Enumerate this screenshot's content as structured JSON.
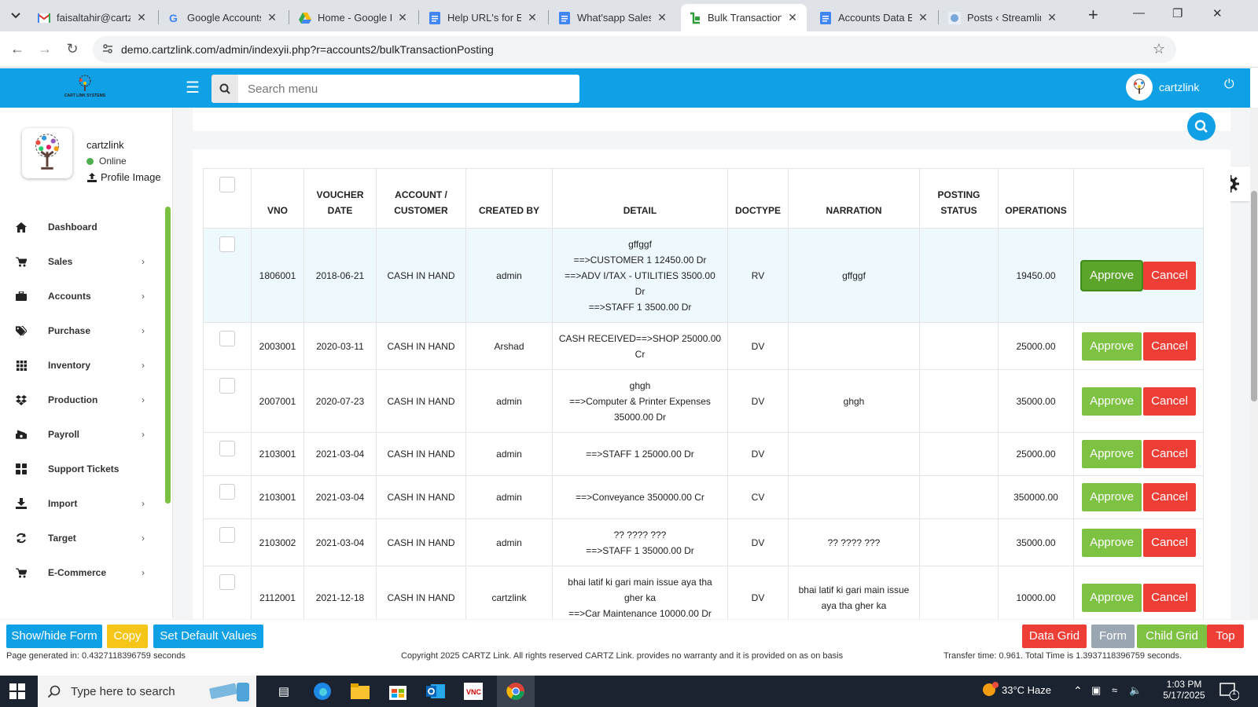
{
  "browser": {
    "tabs": [
      {
        "label": "faisaltahir@cartzli",
        "icon": "gmail-icon",
        "active": false
      },
      {
        "label": "Google Accounts",
        "icon": "google-icon",
        "active": false
      },
      {
        "label": "Home - Google Dr",
        "icon": "drive-icon",
        "active": false
      },
      {
        "label": "Help URL's for ERP",
        "icon": "docs-icon",
        "active": false
      },
      {
        "label": "What'sapp Sales M",
        "icon": "docs-icon",
        "active": false
      },
      {
        "label": "Bulk Transaction P",
        "icon": "cartz-icon",
        "active": true
      },
      {
        "label": "Accounts Data Ent",
        "icon": "docs-icon",
        "active": false
      },
      {
        "label": "Posts ‹ Streamline",
        "icon": "site-icon",
        "active": false
      }
    ],
    "url": "demo.cartzlink.com/admin/indexyii.php?r=accounts2/bulkTransactionPosting"
  },
  "header": {
    "logo_text": "CART LINK SYSTEMS",
    "search_placeholder": "Search menu",
    "user": "cartzlink"
  },
  "sidebar": {
    "profile_name": "cartzlink",
    "status": "Online",
    "profile_image_label": "Profile Image",
    "items": [
      {
        "label": "Dashboard",
        "icon": "home-icon",
        "has_children": false
      },
      {
        "label": "Sales",
        "icon": "cart-icon",
        "has_children": true
      },
      {
        "label": "Accounts",
        "icon": "briefcase-icon",
        "has_children": true
      },
      {
        "label": "Purchase",
        "icon": "tags-icon",
        "has_children": true
      },
      {
        "label": "Inventory",
        "icon": "grid-icon",
        "has_children": true
      },
      {
        "label": "Production",
        "icon": "dropbox-icon",
        "has_children": true
      },
      {
        "label": "Payroll",
        "icon": "money-icon",
        "has_children": true
      },
      {
        "label": "Support Tickets",
        "icon": "ticket-icon",
        "has_children": false
      },
      {
        "label": "Import",
        "icon": "import-icon",
        "has_children": true
      },
      {
        "label": "Target",
        "icon": "refresh-icon",
        "has_children": true
      },
      {
        "label": "E-Commerce",
        "icon": "cart-icon",
        "has_children": true
      }
    ]
  },
  "table": {
    "columns": [
      "VNO",
      "VOUCHER DATE",
      "ACCOUNT / CUSTOMER",
      "CREATED BY",
      "DETAIL",
      "DOCTYPE",
      "NARRATION",
      "POSTING STATUS",
      "OPERATIONS"
    ],
    "approve_label": "Approve",
    "cancel_label": "Cancel",
    "rows": [
      {
        "vno": "1806001",
        "date": "2018-06-21",
        "account": "CASH IN HAND",
        "created_by": "admin",
        "detail": [
          "gffggf",
          "==>CUSTOMER 1 12450.00 Dr",
          "==>ADV I/TAX - UTILITIES 3500.00",
          "Dr",
          "==>STAFF 1 3500.00 Dr"
        ],
        "doctype": "RV",
        "narration": "gffggf",
        "posting_status": "",
        "amount": "19450.00"
      },
      {
        "vno": "2003001",
        "date": "2020-03-11",
        "account": "CASH IN HAND",
        "created_by": "Arshad",
        "detail": [
          "CASH RECEIVED==>SHOP 25000.00",
          "Cr"
        ],
        "doctype": "DV",
        "narration": "",
        "posting_status": "",
        "amount": "25000.00"
      },
      {
        "vno": "2007001",
        "date": "2020-07-23",
        "account": "CASH IN HAND",
        "created_by": "admin",
        "detail": [
          "ghgh",
          "==>Computer & Printer Expenses",
          "35000.00 Dr"
        ],
        "doctype": "DV",
        "narration": "ghgh",
        "posting_status": "",
        "amount": "35000.00"
      },
      {
        "vno": "2103001",
        "date": "2021-03-04",
        "account": "CASH IN HAND",
        "created_by": "admin",
        "detail": [
          "==>STAFF 1 25000.00 Dr"
        ],
        "doctype": "DV",
        "narration": "",
        "posting_status": "",
        "amount": "25000.00"
      },
      {
        "vno": "2103001",
        "date": "2021-03-04",
        "account": "CASH IN HAND",
        "created_by": "admin",
        "detail": [
          "==>Conveyance 350000.00 Cr"
        ],
        "doctype": "CV",
        "narration": "",
        "posting_status": "",
        "amount": "350000.00"
      },
      {
        "vno": "2103002",
        "date": "2021-03-04",
        "account": "CASH IN HAND",
        "created_by": "admin",
        "detail": [
          "?? ???? ???",
          "==>STAFF 1 35000.00 Dr"
        ],
        "doctype": "DV",
        "narration": "?? ???? ???",
        "posting_status": "",
        "amount": "35000.00"
      },
      {
        "vno": "2112001",
        "date": "2021-12-18",
        "account": "CASH IN HAND",
        "created_by": "cartzlink",
        "detail": [
          "bhai latif ki gari main issue aya tha",
          "gher ka",
          "==>Car Maintenance 10000.00 Dr"
        ],
        "doctype": "DV",
        "narration": "bhai latif ki gari main issue aya tha gher ka",
        "posting_status": "",
        "amount": "10000.00"
      }
    ]
  },
  "bottom": {
    "left_buttons": [
      {
        "label": "Show/hide Form",
        "color": "#0fa0e6"
      },
      {
        "label": "Copy",
        "color": "#f5c518"
      },
      {
        "label": "Set Default Values",
        "color": "#0fa0e6"
      }
    ],
    "right_buttons": [
      {
        "label": "Data Grid",
        "color": "#ef3e36"
      },
      {
        "label": "Form",
        "color": "#9aa7b3"
      },
      {
        "label": "Child Grid",
        "color": "#7dc243"
      },
      {
        "label": "Top",
        "color": "#ef3e36"
      }
    ],
    "page_generated": "Page generated in: 0.4327118396759 seconds",
    "copyright": "Copyright 2025 CARTZ Link. All rights reserved CARTZ Link. provides no warranty and it is provided on as on basis",
    "transfer": "Transfer time: 0.961. Total Time is 1.3937118396759 seconds."
  },
  "taskbar": {
    "search_placeholder": "Type here to search",
    "weather": "33°C  Haze",
    "time": "1:03 PM",
    "date": "5/17/2025",
    "notification_count": "1"
  }
}
